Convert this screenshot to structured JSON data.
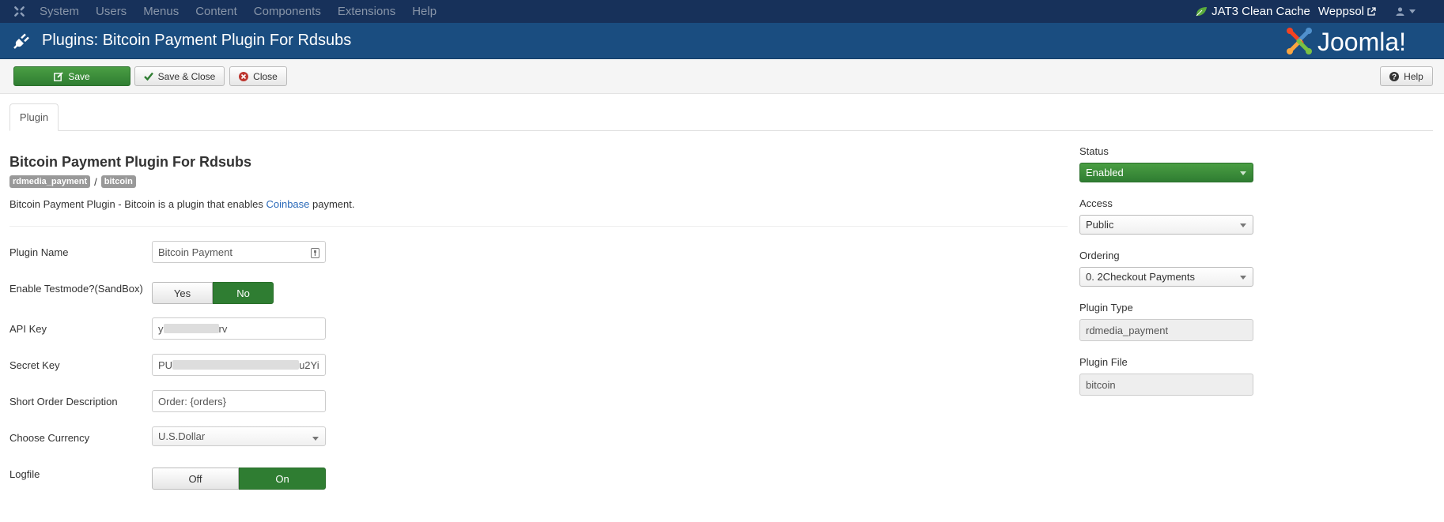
{
  "topnav": {
    "menu": [
      "System",
      "Users",
      "Menus",
      "Content",
      "Components",
      "Extensions",
      "Help"
    ],
    "cache_label": "JAT3 Clean Cache",
    "site_label": "Weppsol"
  },
  "header": {
    "title": "Plugins: Bitcoin Payment Plugin For Rdsubs",
    "brand": "Joomla!"
  },
  "toolbar": {
    "save_label": "Save",
    "save_close_label": "Save & Close",
    "close_label": "Close",
    "help_label": "Help"
  },
  "tabs": [
    {
      "label": "Plugin"
    }
  ],
  "plugin": {
    "title": "Bitcoin Payment Plugin For Rdsubs",
    "tag_folder": "rdmedia_payment",
    "tag_separator": "/",
    "tag_element": "bitcoin",
    "desc_before": "Bitcoin Payment Plugin - Bitcoin is a plugin that enables ",
    "desc_link": "Coinbase",
    "desc_after": " payment."
  },
  "form": {
    "plugin_name_label": "Plugin Name",
    "plugin_name_value": "Bitcoin Payment",
    "testmode_label": "Enable Testmode?(SandBox)",
    "testmode_yes": "Yes",
    "testmode_no": "No",
    "api_key_label": "API Key",
    "api_key_start": "y",
    "api_key_end": "rv",
    "secret_key_label": "Secret Key",
    "secret_key_start": "PU",
    "secret_key_end": "u2Yi",
    "short_desc_label": "Short Order Description",
    "short_desc_value": "Order: {orders}",
    "currency_label": "Choose Currency",
    "currency_value": "U.S.Dollar",
    "logfile_label": "Logfile",
    "logfile_off": "Off",
    "logfile_on": "On"
  },
  "sidebar": {
    "status_label": "Status",
    "status_value": "Enabled",
    "access_label": "Access",
    "access_value": "Public",
    "ordering_label": "Ordering",
    "ordering_value": "0. 2Checkout Payments",
    "plugin_type_label": "Plugin Type",
    "plugin_type_value": "rdmedia_payment",
    "plugin_file_label": "Plugin File",
    "plugin_file_value": "bitcoin"
  },
  "colors": {
    "topnav_bg": "#17315a",
    "header_bg": "#1a4d80",
    "success": "#2f7d32",
    "link": "#2a69b8"
  }
}
